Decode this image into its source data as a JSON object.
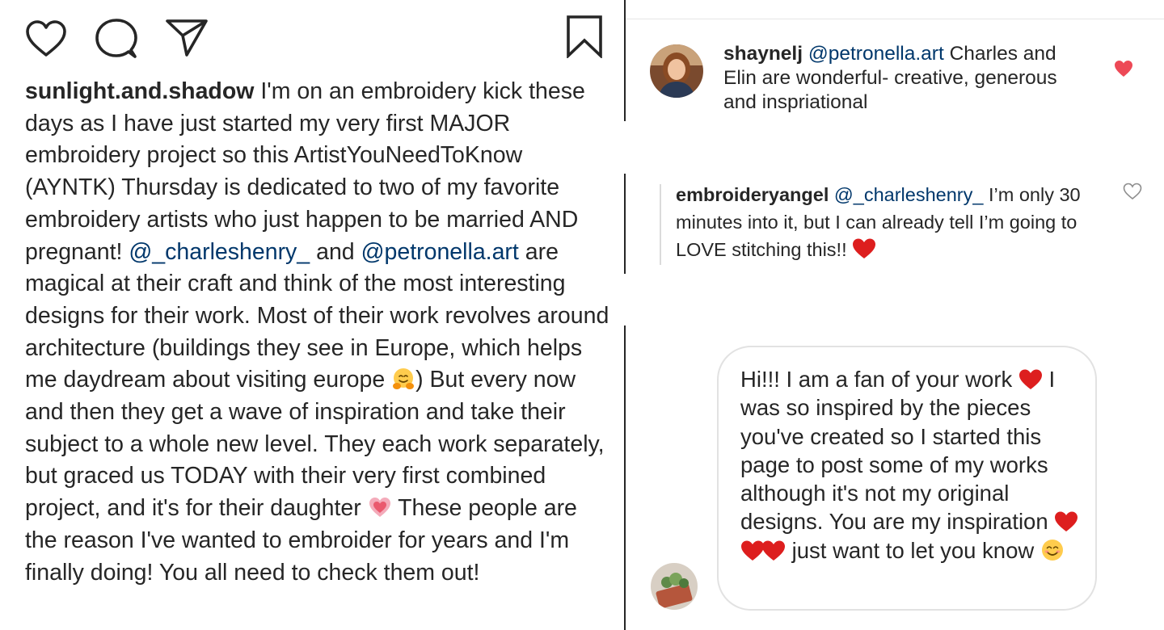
{
  "post": {
    "caption": {
      "username": "sunlight.and.shadow",
      "text_1": " I'm on an embroidery kick these days as I have just started my very first MAJOR embroidery project so this ArtistYouNeedToKnow (AYNTK) Thursday is dedicated to two of my favorite embroidery artists who just happen to be married AND pregnant! ",
      "mention_1": "@_charleshenry_",
      "text_2": "  and ",
      "mention_2": "@petronella.art",
      "text_3": " are magical at their craft and think of the most interesting designs for their work. Most of their work revolves around architecture (buildings they see in Europe, which helps me daydream about visiting europe ",
      "emoji_1": "hugging-face",
      "text_4": ") But every now and then they get a wave of inspiration and take their subject to a whole new level. They each work separately, but graced us TODAY with their very first combined project, and it's for their daughter ",
      "emoji_2": "sparkling-heart",
      "text_5": " These people are the reason I've wanted to embroider for years and I'm finally doing! You all need to check them out!"
    },
    "actions": [
      "heart-icon",
      "comment-icon",
      "share-icon",
      "bookmark-icon"
    ]
  },
  "comments": [
    {
      "username": "shaynelj",
      "mention": "@petronella.art",
      "text": " Charles and Elin are wonderful- creative, generous and inspriational",
      "liked": true
    },
    {
      "username": "embroideryangel",
      "mention": "@_charleshenry_",
      "text_a": " I’m only 30 minutes into it, but I can already tell I’m going to LOVE stitching this!! ",
      "emoji": "red-heart",
      "liked": false
    }
  ],
  "message": {
    "text_1": "Hi!!! I am a fan of your work ",
    "text_2": " I was so inspired by the pieces you've created so I started this page to post some of my works although it's not my original designs. You are my inspiration ",
    "text_3": " just want to let you know ",
    "emojis": [
      "red-heart",
      "red-heart",
      "red-heart",
      "red-heart",
      "smiling-face"
    ]
  },
  "colors": {
    "text": "#262626",
    "mention": "#00376b",
    "like_red": "#ed4956",
    "heart_emoji": "#dd1e1e"
  }
}
